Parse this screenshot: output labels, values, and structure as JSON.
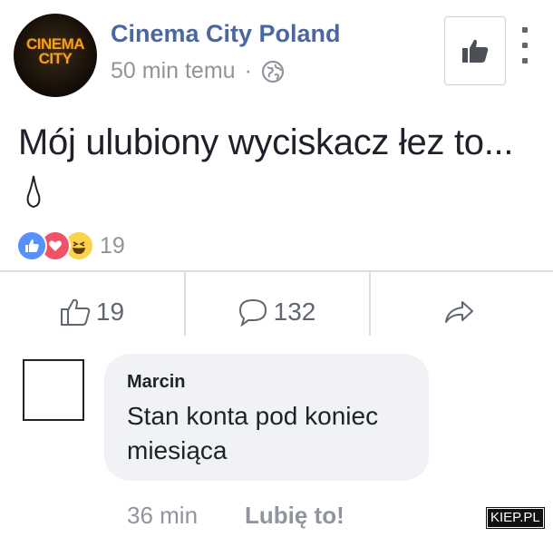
{
  "post": {
    "page_name": "Cinema City Poland",
    "avatar_logo_line1": "CINEMA",
    "avatar_logo_line2": "CITY",
    "time": "50 min temu",
    "separator": "·",
    "privacy_icon": "globe-icon",
    "text": "Mój ulubiony wyciskacz łez to...",
    "reaction_icons": [
      "like-reaction-icon",
      "love-reaction-icon",
      "haha-reaction-icon"
    ],
    "reaction_count": "19"
  },
  "actions": {
    "like_count": "19",
    "comment_count": "132",
    "share_icon": "share-icon"
  },
  "comment": {
    "author": "Marcin",
    "text": "Stan konta pod koniec miesiąca",
    "time": "36 min",
    "like_label": "Lubię to!"
  },
  "watermark": {
    "text": "KIEP.PL"
  },
  "colors": {
    "page_name": "#4b67a1",
    "meta_gray": "#90949c",
    "like_blue": "#5890ff",
    "love_red": "#f25268",
    "haha_yellow": "#fcd34d",
    "bubble_bg": "#f0f2f5",
    "logo_orange": "#f4a019"
  }
}
